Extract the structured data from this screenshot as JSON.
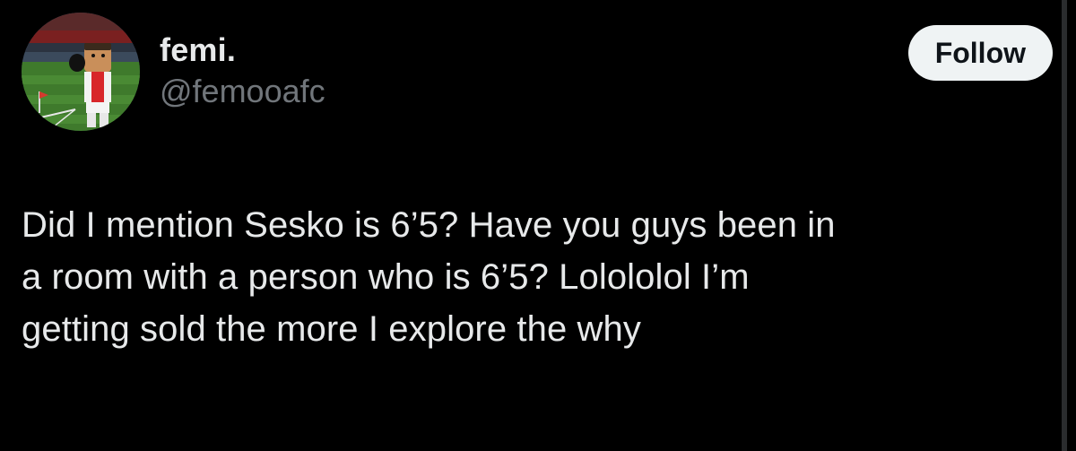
{
  "author": {
    "display_name": "femi.",
    "handle": "@femooafc"
  },
  "actions": {
    "follow_label": "Follow"
  },
  "tweet": {
    "text": "Did I mention Sesko is 6’5? Have you guys been in\na room with a person who is 6’5? Lolololol I’m\ngetting sold the more I explore the why"
  },
  "colors": {
    "background": "#000000",
    "primary_text": "#e7e9ea",
    "secondary_text": "#71767b",
    "follow_button_bg": "#eff3f4",
    "follow_button_text": "#0f1419"
  }
}
